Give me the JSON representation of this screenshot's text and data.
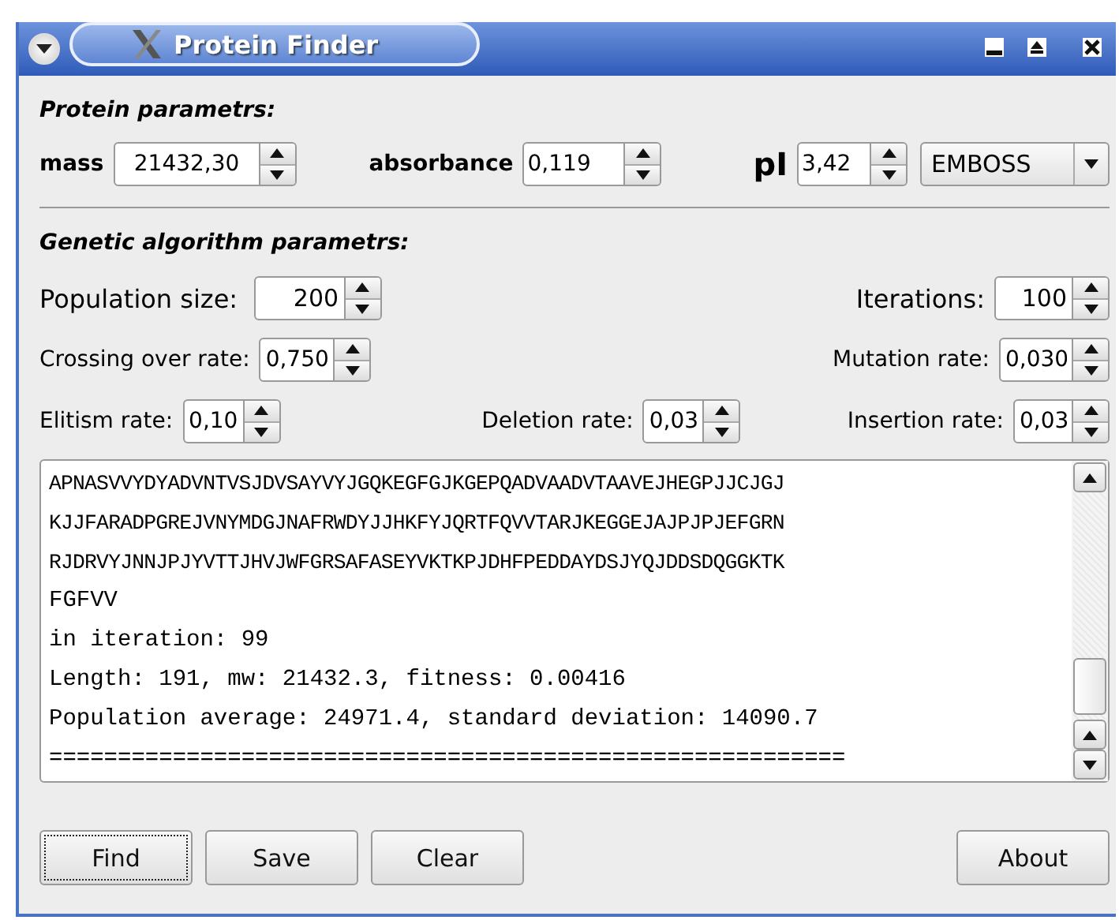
{
  "window": {
    "title": "Protein Finder"
  },
  "protein_section": {
    "title": "Protein parametrs:",
    "fields": [
      {
        "label": "mass",
        "value": "21432,30"
      },
      {
        "label": "absorbance",
        "value": "0,119"
      },
      {
        "label": "pI",
        "value": "3,42"
      }
    ],
    "method_dropdown": {
      "value": "EMBOSS"
    }
  },
  "genetic_section": {
    "title": "Genetic algorithm parametrs:",
    "rows": [
      [
        {
          "label": "Population size:",
          "value": "200"
        },
        {
          "label": "Iterations:",
          "value": "100"
        }
      ],
      [
        {
          "label": "Crossing over rate:",
          "value": "0,750"
        },
        {
          "label": "Mutation rate:",
          "value": "0,030"
        }
      ],
      [
        {
          "label": "Elitism rate:",
          "value": "0,10"
        },
        {
          "label": "Deletion rate:",
          "value": "0,03"
        },
        {
          "label": "Insertion rate:",
          "value": "0,03"
        }
      ]
    ]
  },
  "output": {
    "lines": [
      "APNASVVYDYADVNTVSJDVSAYVYJGQKEGFGJKGEPQADVAADVTAAVEJHEGPJJCJGJ",
      "KJJFARADPGREJVNYMDGJNAFRWDYJJHKFYJQRTFQVVTARJKEGGEJAJPJPJEFGRN",
      "RJDRVYJNNJPJYVTTJHVJWFGRSAFASEYVKTKPJDHFPEDDAYDSJYQJDDSDQGGKTK",
      "FGFVV",
      "in iteration: 99",
      "Length: 191, mw: 21432.3, fitness: 0.00416",
      "Population average: 24971.4, standard deviation: 14090.7",
      "=========================================================="
    ]
  },
  "buttons": [
    {
      "label": "Find",
      "focused": true
    },
    {
      "label": "Save",
      "focused": false
    },
    {
      "label": "Clear",
      "focused": false
    },
    {
      "label": "About",
      "focused": false
    }
  ]
}
